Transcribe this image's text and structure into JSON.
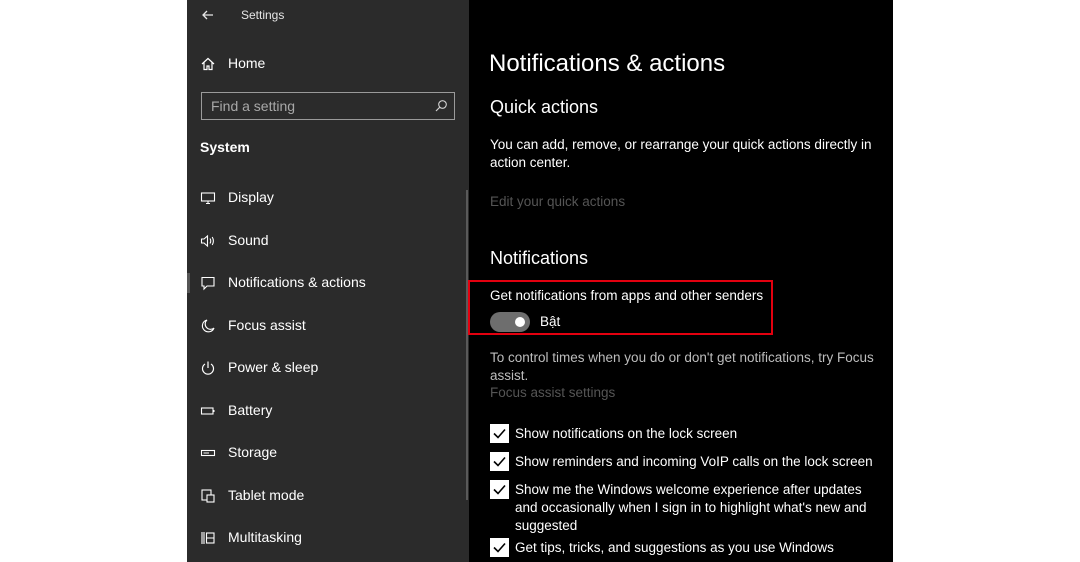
{
  "window": {
    "title": "Settings"
  },
  "sidebar": {
    "home_label": "Home",
    "search_placeholder": "Find a setting",
    "group_heading": "System",
    "items": [
      {
        "label": "Display",
        "icon": "monitor-icon"
      },
      {
        "label": "Sound",
        "icon": "speaker-icon"
      },
      {
        "label": "Notifications & actions",
        "icon": "message-icon",
        "active": true
      },
      {
        "label": "Focus assist",
        "icon": "moon-icon"
      },
      {
        "label": "Power & sleep",
        "icon": "power-icon"
      },
      {
        "label": "Battery",
        "icon": "battery-icon"
      },
      {
        "label": "Storage",
        "icon": "storage-icon"
      },
      {
        "label": "Tablet mode",
        "icon": "tablet-mode-icon"
      },
      {
        "label": "Multitasking",
        "icon": "multitasking-icon"
      }
    ]
  },
  "main": {
    "page_title": "Notifications & actions",
    "quick_actions": {
      "heading": "Quick actions",
      "description": "You can add, remove, or rearrange your quick actions directly in action center.",
      "edit_link": "Edit your quick actions"
    },
    "notifications": {
      "heading": "Notifications",
      "toggle_label": "Get notifications from apps and other senders",
      "toggle_state": "Bật",
      "toggle_on": true,
      "focus_text": "To control times when you do or don't get notifications, try Focus assist.",
      "focus_link": "Focus assist settings",
      "checkboxes": [
        {
          "label": "Show notifications on the lock screen",
          "checked": true
        },
        {
          "label": "Show reminders and incoming VoIP calls on the lock screen",
          "checked": true
        },
        {
          "label": "Show me the Windows welcome experience after updates and occasionally when I sign in to highlight what's new and suggested",
          "checked": true
        },
        {
          "label": "Get tips, tricks, and suggestions as you use Windows",
          "checked": true
        }
      ]
    }
  },
  "colors": {
    "sidebar_bg": "#2b2b2b",
    "content_bg": "#000000",
    "highlight_border": "#e3000f",
    "disabled_link": "#555555"
  }
}
